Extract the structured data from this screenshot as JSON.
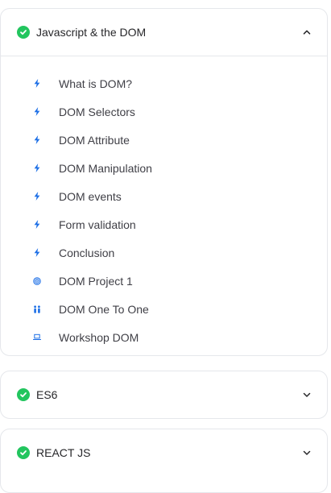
{
  "colors": {
    "accent": "#1d6fe6",
    "complete": "#22c55e",
    "border": "#e5e7eb"
  },
  "sections": [
    {
      "title": "Javascript & the DOM",
      "expanded": true,
      "completed": true,
      "chevron_icon": "chevron-up-icon",
      "lessons": [
        {
          "label": "What is DOM?",
          "icon": "lightning-icon"
        },
        {
          "label": "DOM Selectors",
          "icon": "lightning-icon"
        },
        {
          "label": "DOM Attribute",
          "icon": "lightning-icon"
        },
        {
          "label": "DOM Manipulation",
          "icon": "lightning-icon"
        },
        {
          "label": "DOM events",
          "icon": "lightning-icon"
        },
        {
          "label": "Form validation",
          "icon": "lightning-icon"
        },
        {
          "label": "Conclusion",
          "icon": "lightning-icon"
        },
        {
          "label": "DOM Project 1",
          "icon": "target-icon"
        },
        {
          "label": "DOM One To One",
          "icon": "people-icon"
        },
        {
          "label": "Workshop DOM",
          "icon": "laptop-icon"
        }
      ]
    },
    {
      "title": "ES6",
      "expanded": false,
      "completed": true,
      "chevron_icon": "chevron-down-icon"
    },
    {
      "title": "REACT JS",
      "expanded": false,
      "completed": true,
      "chevron_icon": "chevron-down-icon"
    }
  ]
}
